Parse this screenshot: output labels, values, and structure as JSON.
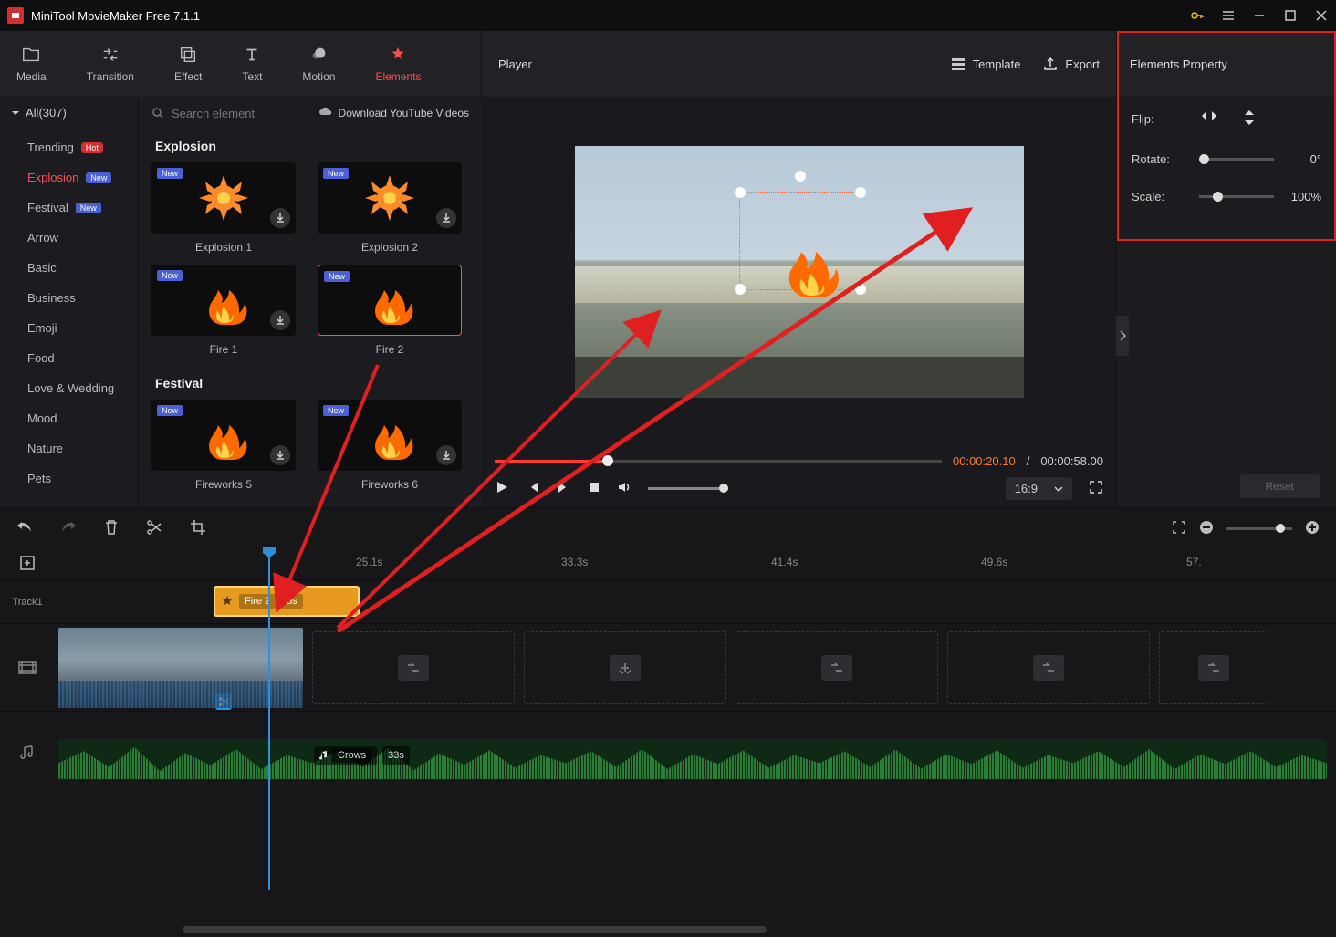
{
  "app": {
    "title": "MiniTool MovieMaker Free 7.1.1"
  },
  "toolbar": {
    "tabs": [
      {
        "label": "Media"
      },
      {
        "label": "Transition"
      },
      {
        "label": "Effect"
      },
      {
        "label": "Text"
      },
      {
        "label": "Motion"
      },
      {
        "label": "Elements"
      }
    ]
  },
  "player": {
    "title": "Player",
    "template": "Template",
    "export": "Export",
    "time_current": "00:00:20.10",
    "time_sep": "/",
    "time_total": "00:00:58.00",
    "aspect": "16:9"
  },
  "properties": {
    "header": "Elements Property",
    "flip_label": "Flip:",
    "rotate_label": "Rotate:",
    "rotate_value": "0°",
    "scale_label": "Scale:",
    "scale_value": "100%",
    "reset": "Reset"
  },
  "sidebar": {
    "all": "All(307)",
    "items": [
      {
        "label": "Trending",
        "badge": "Hot",
        "badgeClass": "hot"
      },
      {
        "label": "Explosion",
        "badge": "New",
        "badgeClass": "new",
        "active": true
      },
      {
        "label": "Festival",
        "badge": "New",
        "badgeClass": "new"
      },
      {
        "label": "Arrow"
      },
      {
        "label": "Basic"
      },
      {
        "label": "Business"
      },
      {
        "label": "Emoji"
      },
      {
        "label": "Food"
      },
      {
        "label": "Love & Wedding"
      },
      {
        "label": "Mood"
      },
      {
        "label": "Nature"
      },
      {
        "label": "Pets"
      }
    ]
  },
  "elements": {
    "search_placeholder": "Search element",
    "download_link": "Download YouTube Videos",
    "sections": [
      {
        "title": "Explosion",
        "items": [
          {
            "label": "Explosion 1",
            "new": true,
            "dl": true
          },
          {
            "label": "Explosion 2",
            "new": true,
            "dl": true
          },
          {
            "label": "Fire 1",
            "new": true,
            "dl": true
          },
          {
            "label": "Fire 2",
            "new": true,
            "selected": true
          }
        ]
      },
      {
        "title": "Festival",
        "items": [
          {
            "label": "Fireworks 5",
            "new": true,
            "dl": true
          },
          {
            "label": "Fireworks 6",
            "new": true,
            "dl": true
          }
        ]
      }
    ]
  },
  "timeline": {
    "ruler": [
      "25.1s",
      "33.3s",
      "41.4s",
      "49.6s",
      "57."
    ],
    "track1_label": "Track1",
    "element_clip_name": "Fire 2",
    "element_clip_dur": "5s",
    "audio_name": "Crows",
    "audio_dur": "33s"
  },
  "annotations": {
    "highlight_panel": "Elements Property panel (Flip / Rotate / Scale)",
    "arrows": "Fire 2 thumbnail → timeline clip → preview → properties panel"
  }
}
